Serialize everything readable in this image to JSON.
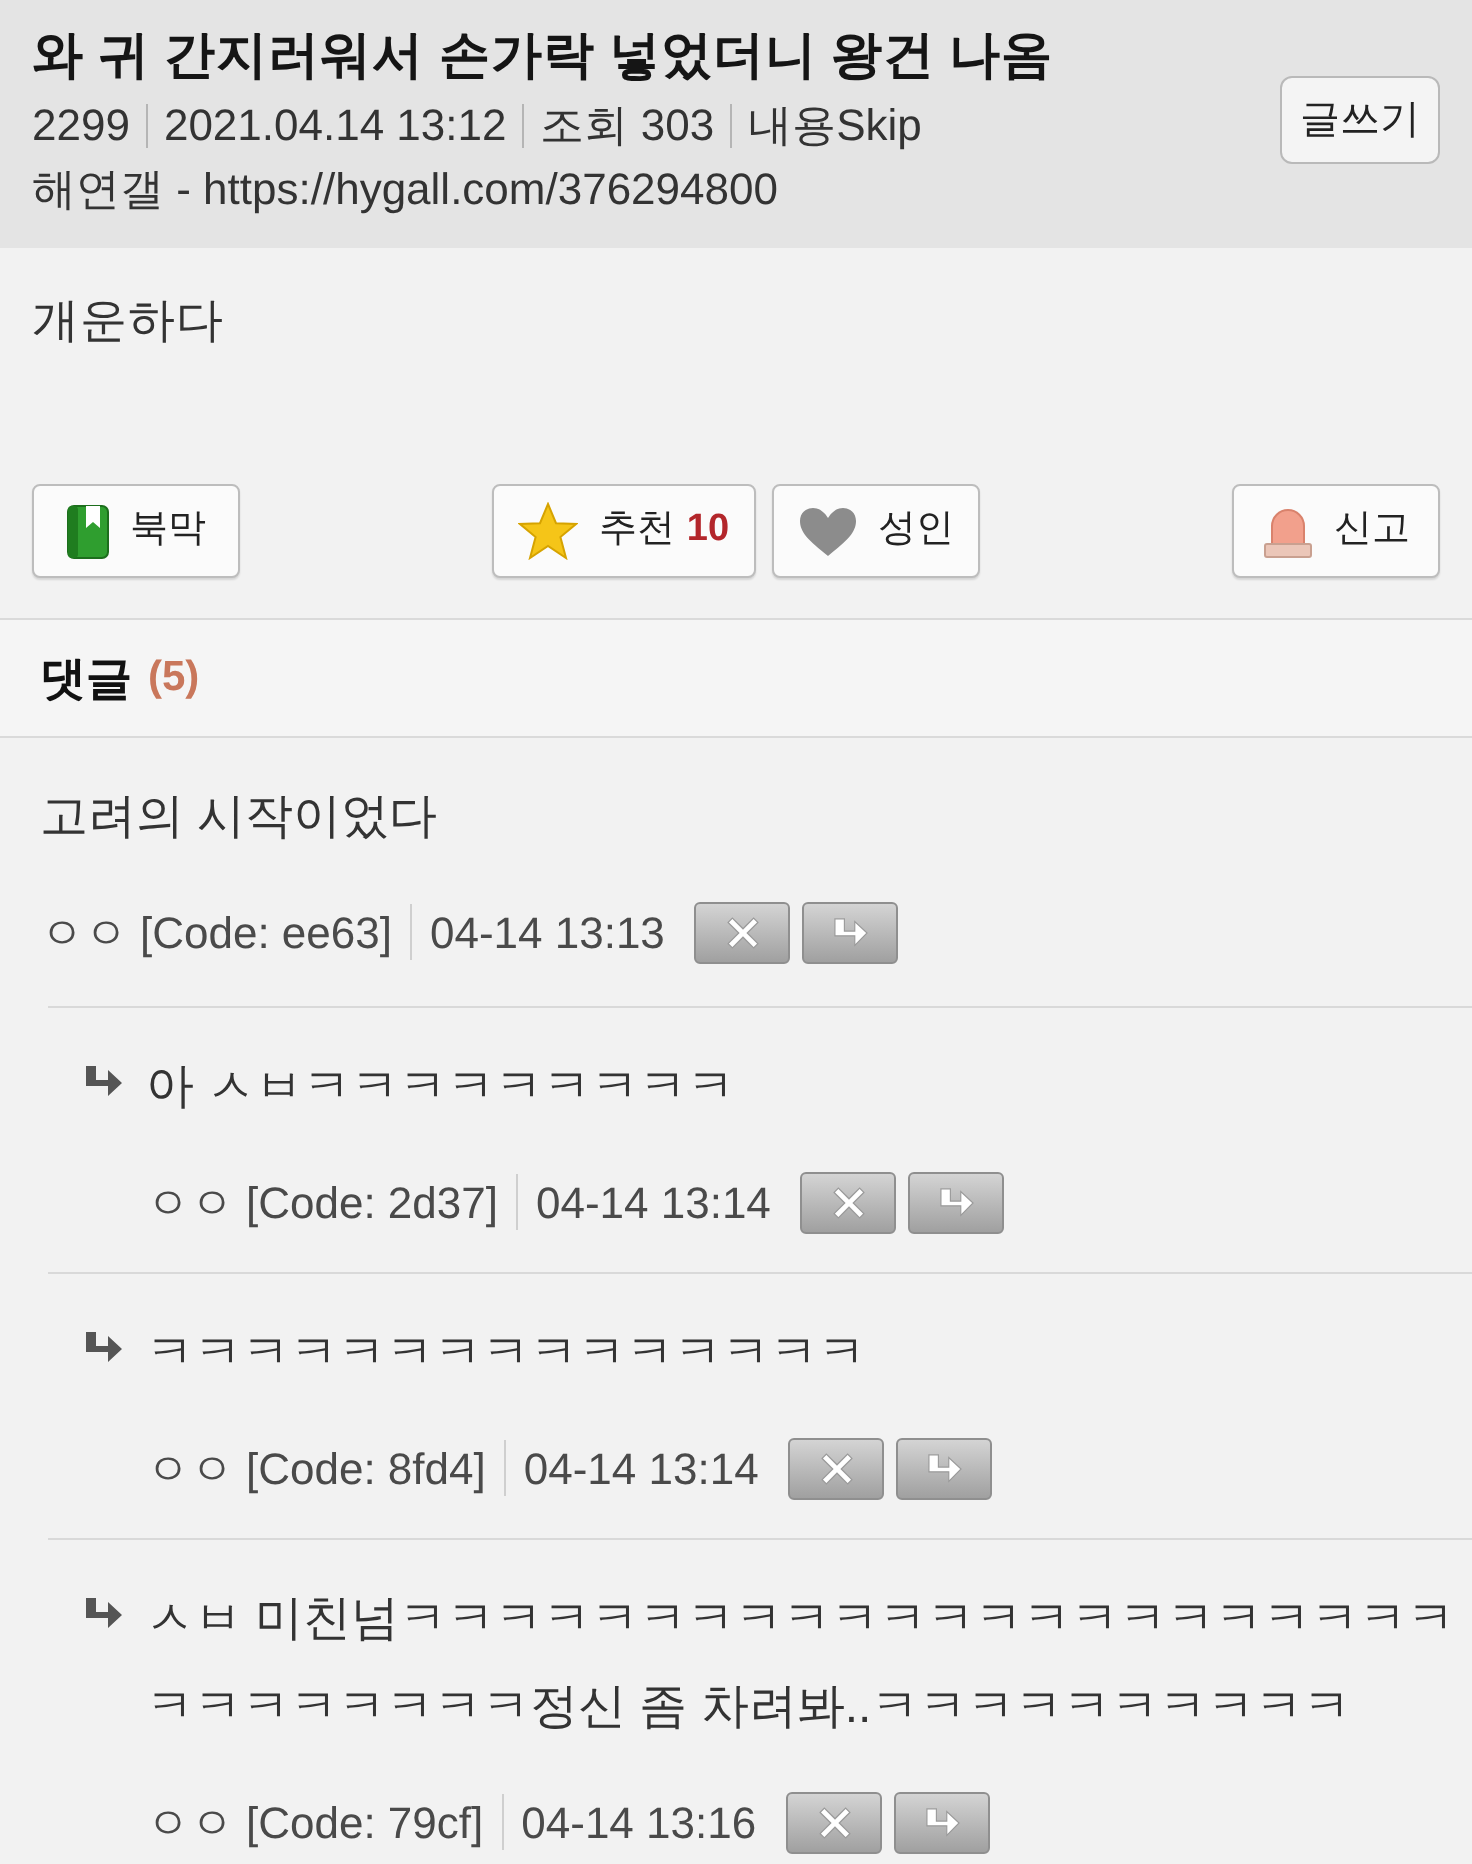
{
  "post": {
    "title": "와 귀 간지러워서 손가락 넣었더니 왕건 나옴",
    "meta": [
      "2299",
      "2021.04.14 13:12",
      "조회 303",
      "내용Skip"
    ],
    "source": "해연갤 - https://hygall.com/376294800",
    "write_button": "글쓰기",
    "body": "개운하다"
  },
  "actions": [
    {
      "kind": "bookmark",
      "label": "북막"
    },
    {
      "kind": "recommend",
      "label": "추천",
      "count": "10"
    },
    {
      "kind": "adult",
      "label": "성인"
    },
    {
      "kind": "report",
      "label": "신고"
    }
  ],
  "comments_header": {
    "title": "댓글",
    "count": "(5)"
  },
  "comments": [
    {
      "text": "고려의 시작이었다",
      "author": "ㅇㅇ",
      "code": "[Code: ee63]",
      "time": "04-14 13:13",
      "children": [
        {
          "text": "아 ㅅㅂㅋㅋㅋㅋㅋㅋㅋㅋㅋ",
          "author": "ㅇㅇ",
          "code": "[Code: 2d37]",
          "time": "04-14 13:14"
        },
        {
          "text": "ㅋㅋㅋㅋㅋㅋㅋㅋㅋㅋㅋㅋㅋㅋㅋ",
          "author": "ㅇㅇ",
          "code": "[Code: 8fd4]",
          "time": "04-14 13:14"
        },
        {
          "text": "ㅅㅂ 미친넘ㅋㅋㅋㅋㅋㅋㅋㅋㅋㅋㅋㅋㅋㅋㅋㅋㅋㅋㅋㅋㅋㅋㅋㅋㅋㅋㅋㅋㅋㅋ정신 좀 차려봐..ㅋㅋㅋㅋㅋㅋㅋㅋㅋㅋ",
          "author": "ㅇㅇ",
          "code": "[Code: 79cf]",
          "time": "04-14 13:16"
        }
      ]
    }
  ]
}
